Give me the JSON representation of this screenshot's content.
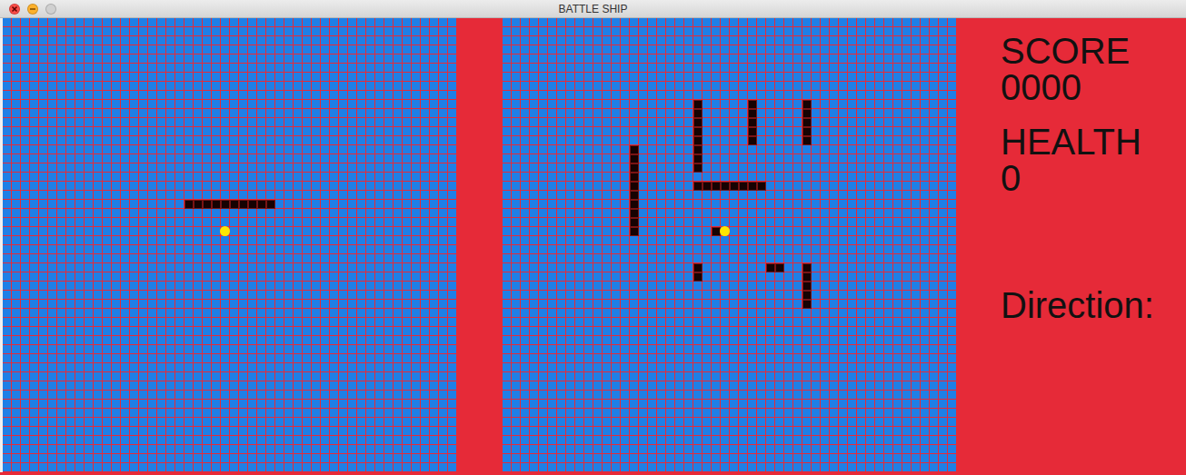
{
  "window": {
    "title": "BATTLE SHIP",
    "controls": [
      {
        "kind": "close",
        "color": "#fc4c47",
        "disabled": false
      },
      {
        "kind": "minimize",
        "color": "#fdb12c",
        "disabled": false
      },
      {
        "kind": "zoom",
        "color": "#d0d0d0",
        "disabled": true
      }
    ]
  },
  "boards": [
    {
      "name": "player-board",
      "rows": 50,
      "cols": 50,
      "ships": [
        {
          "row": 20,
          "col": 20,
          "length": 10,
          "vertical": false
        }
      ],
      "markers": [
        {
          "row": 23,
          "col": 24
        }
      ]
    },
    {
      "name": "enemy-board",
      "rows": 50,
      "cols": 50,
      "ships": [
        {
          "row": 9,
          "col": 21,
          "length": 8,
          "vertical": true
        },
        {
          "row": 9,
          "col": 27,
          "length": 5,
          "vertical": true
        },
        {
          "row": 9,
          "col": 33,
          "length": 5,
          "vertical": true
        },
        {
          "row": 14,
          "col": 14,
          "length": 10,
          "vertical": true
        },
        {
          "row": 18,
          "col": 21,
          "length": 8,
          "vertical": false
        },
        {
          "row": 23,
          "col": 23,
          "length": 1,
          "vertical": false
        },
        {
          "row": 27,
          "col": 21,
          "length": 2,
          "vertical": true
        },
        {
          "row": 27,
          "col": 29,
          "length": 2,
          "vertical": false
        },
        {
          "row": 27,
          "col": 33,
          "length": 5,
          "vertical": true
        }
      ],
      "markers": [
        {
          "row": 23,
          "col": 24
        }
      ]
    }
  ],
  "stats": [
    {
      "label": "SCORE",
      "value": "0000"
    },
    {
      "label": "HEALTH",
      "value": "0"
    }
  ],
  "direction": {
    "label": "Direction:"
  }
}
